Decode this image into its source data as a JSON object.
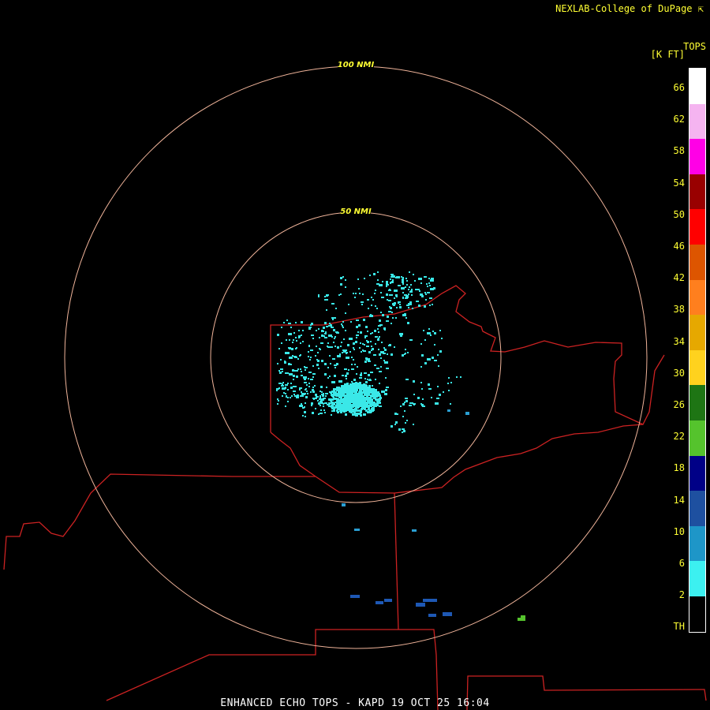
{
  "credit": "NEXLAB-College of DuPage",
  "footer": "ENHANCED ECHO TOPS - KAPD 19 OCT 25 16:04",
  "rings": [
    {
      "label": "100 NMI"
    },
    {
      "label": "50 NMI"
    }
  ],
  "legend": {
    "title": "TOPS",
    "units": "[K FT]",
    "labels": [
      "66",
      "62",
      "58",
      "54",
      "50",
      "46",
      "42",
      "38",
      "34",
      "30",
      "26",
      "22",
      "18",
      "14",
      "10",
      "6",
      "2",
      "TH"
    ],
    "colors": [
      "#ffffff",
      "#f5b4f0",
      "#ff00e6",
      "#990000",
      "#ff0000",
      "#dd5500",
      "#ff7f1e",
      "#e6a800",
      "#ffd21e",
      "#1e7514",
      "#55c32d",
      "#000087",
      "#1e50a0",
      "#1e96c8",
      "#3cf0f0"
    ]
  },
  "colors": {
    "ring": "#f0b49a",
    "boundary": "#cc2222",
    "echo_main": "#3ae8e8",
    "echo_mid": "#2a9ed2",
    "echo_dark": "#1e58b4",
    "echo_green": "#55c32d"
  }
}
